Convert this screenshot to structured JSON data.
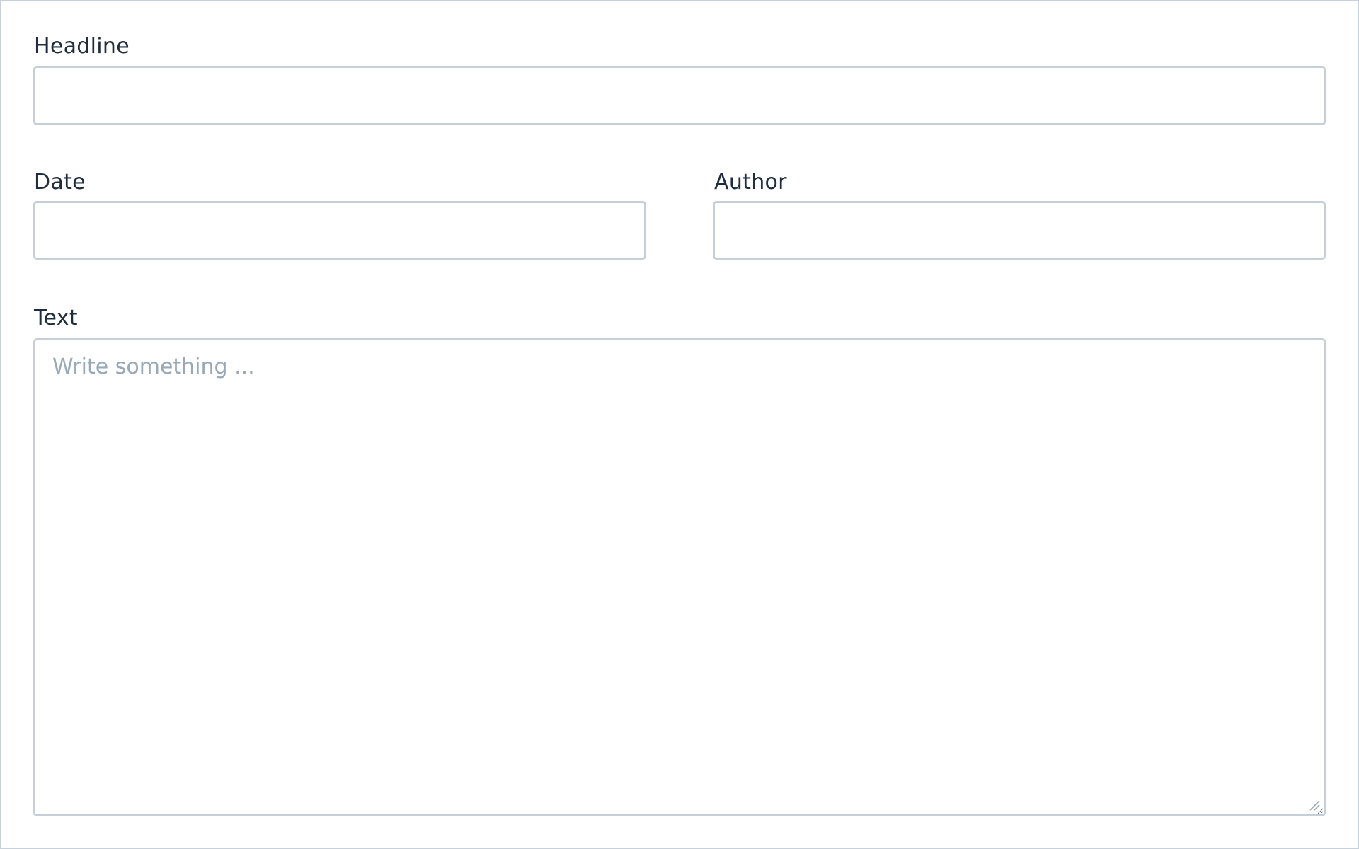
{
  "form": {
    "headline": {
      "label": "Headline",
      "value": "",
      "placeholder": ""
    },
    "date": {
      "label": "Date",
      "value": "",
      "placeholder": ""
    },
    "author": {
      "label": "Author",
      "value": "",
      "placeholder": ""
    },
    "text": {
      "label": "Text",
      "value": "",
      "placeholder": "Write something ..."
    }
  },
  "colors": {
    "border": "#c5cfd9",
    "label": "#1f2d3d",
    "placeholder": "#9aa9b8"
  },
  "icons": {
    "resize_handle": "resize-grip-icon"
  }
}
